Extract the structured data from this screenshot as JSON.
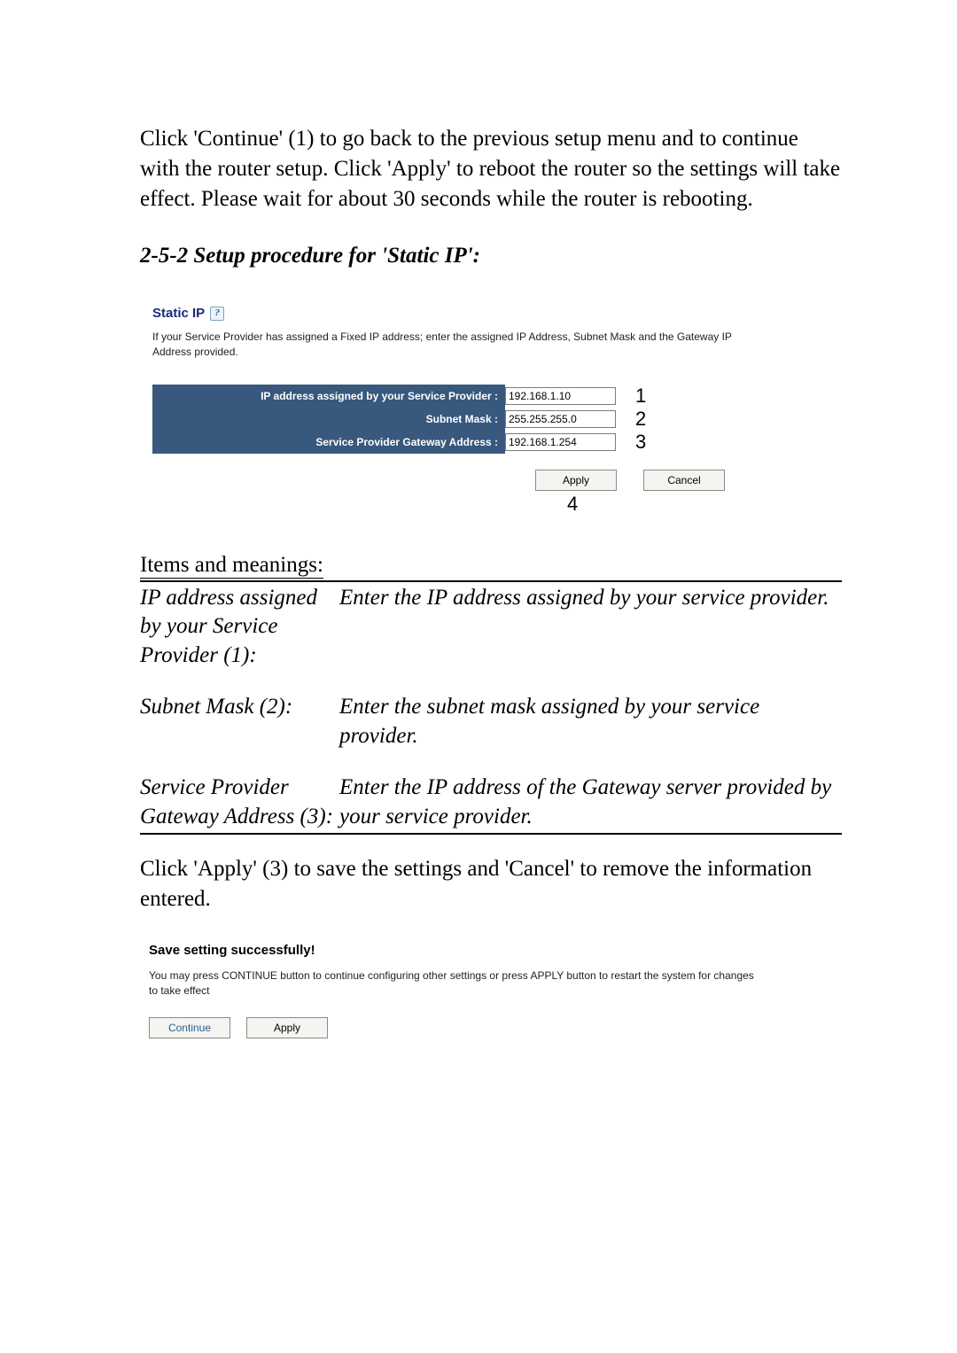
{
  "intro": "Click 'Continue' (1) to go back to the previous setup menu and to continue with the router setup. Click 'Apply' to reboot the router so the settings will take effect. Please wait for about 30 seconds while the router is rebooting.",
  "section_heading": "2-5-2 Setup procedure for 'Static IP':",
  "panel1": {
    "title": "Static IP",
    "help_glyph": "?",
    "desc": "If your Service Provider has assigned a Fixed IP address; enter the assigned IP Address, Subnet Mask and the Gateway IP Address provided.",
    "rows": [
      {
        "label": "IP address assigned by your Service Provider :",
        "value": "192.168.1.10",
        "num": "1"
      },
      {
        "label": "Subnet Mask :",
        "value": "255.255.255.0",
        "num": "2"
      },
      {
        "label": "Service Provider Gateway Address :",
        "value": "192.168.1.254",
        "num": "3"
      }
    ],
    "apply": "Apply",
    "cancel": "Cancel",
    "num4": "4"
  },
  "items_heading": "Items and meanings:",
  "items": [
    {
      "term": "IP address assigned by your Service Provider (1):",
      "def": "Enter the IP address assigned by your service provider."
    },
    {
      "term": "Subnet Mask (2):",
      "def": "Enter the subnet mask assigned by your service provider."
    },
    {
      "term": "Service Provider Gateway Address (3):",
      "def": "Enter the IP address of the Gateway server provided by your service provider."
    }
  ],
  "after_table": "Click 'Apply' (3) to save the settings and 'Cancel' to remove the information entered.",
  "panel2": {
    "title": "Save setting successfully!",
    "desc": "You may press CONTINUE button to continue configuring other settings or press APPLY button to restart the system for changes to take effect",
    "continue": "Continue",
    "apply": "Apply"
  }
}
